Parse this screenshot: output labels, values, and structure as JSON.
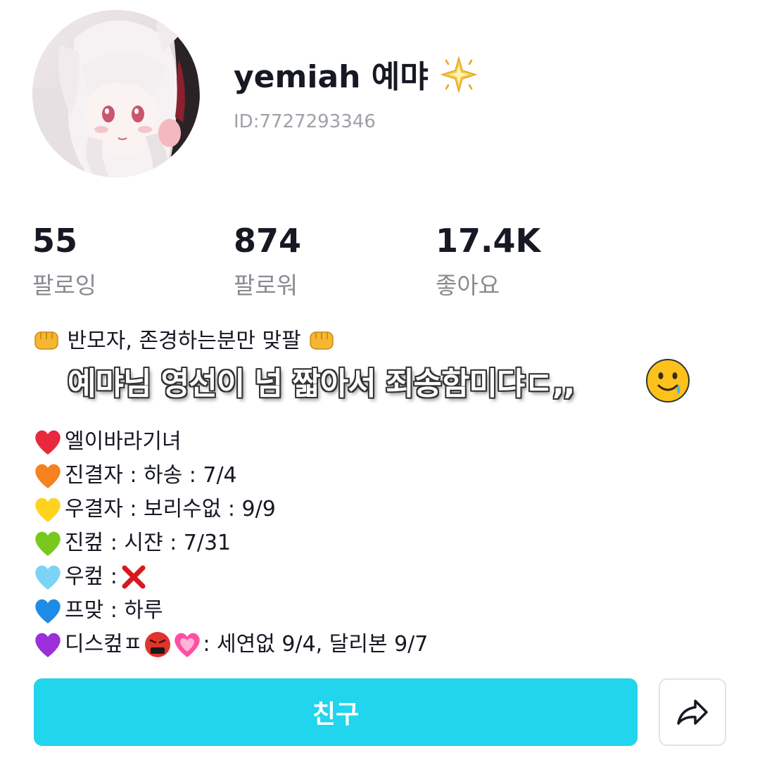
{
  "profile": {
    "username": "yemiah 예먀",
    "star_icon": "sparkle-star-icon",
    "user_id": "ID:7727293346"
  },
  "stats": [
    {
      "value": "55",
      "label": "팔로잉"
    },
    {
      "value": "874",
      "label": "팔로워"
    },
    {
      "value": "17.4K",
      "label": "좋아요"
    }
  ],
  "bio": {
    "line1": "반모자, 존경하는분만 맞팔",
    "line1_icon": "fist-bump-icon",
    "overlay_text": "예먀님 영선이 넘 짧아서 죄송함미댜ㄷ,,",
    "overlay_icon": "smiling-face-with-tear-icon",
    "items": [
      {
        "heart_color": "#e8283c",
        "icon": "red-heart-icon",
        "text": "엘이바라기녀"
      },
      {
        "heart_color": "#f5821f",
        "icon": "orange-heart-icon",
        "text": "진결자 : 하송 : 7/4"
      },
      {
        "heart_color": "#ffd21f",
        "icon": "yellow-heart-icon",
        "text": "우결자 : 보리수없 : 9/9"
      },
      {
        "heart_color": "#78c81e",
        "icon": "green-heart-icon",
        "text": "진컾 : 시쟌 : 7/31"
      },
      {
        "heart_color": "#7dd3f5",
        "icon": "light-blue-heart-icon",
        "text": "우컾 : ",
        "mark": "❌"
      },
      {
        "heart_color": "#1e8ce6",
        "icon": "blue-heart-icon",
        "text": "프맞 : 하루"
      },
      {
        "heart_color": "#9b30d9",
        "icon": "purple-heart-icon",
        "text": "디스컾ㅍ",
        "extra_icons": [
          "cursing-face-icon",
          "pink-heart-icon"
        ],
        "text_after": " : 세연없 9/4, 달리본 9/7"
      }
    ]
  },
  "actions": {
    "follow_label": "친구",
    "follow_color": "#20d5ec",
    "share_icon": "share-arrow-icon"
  }
}
